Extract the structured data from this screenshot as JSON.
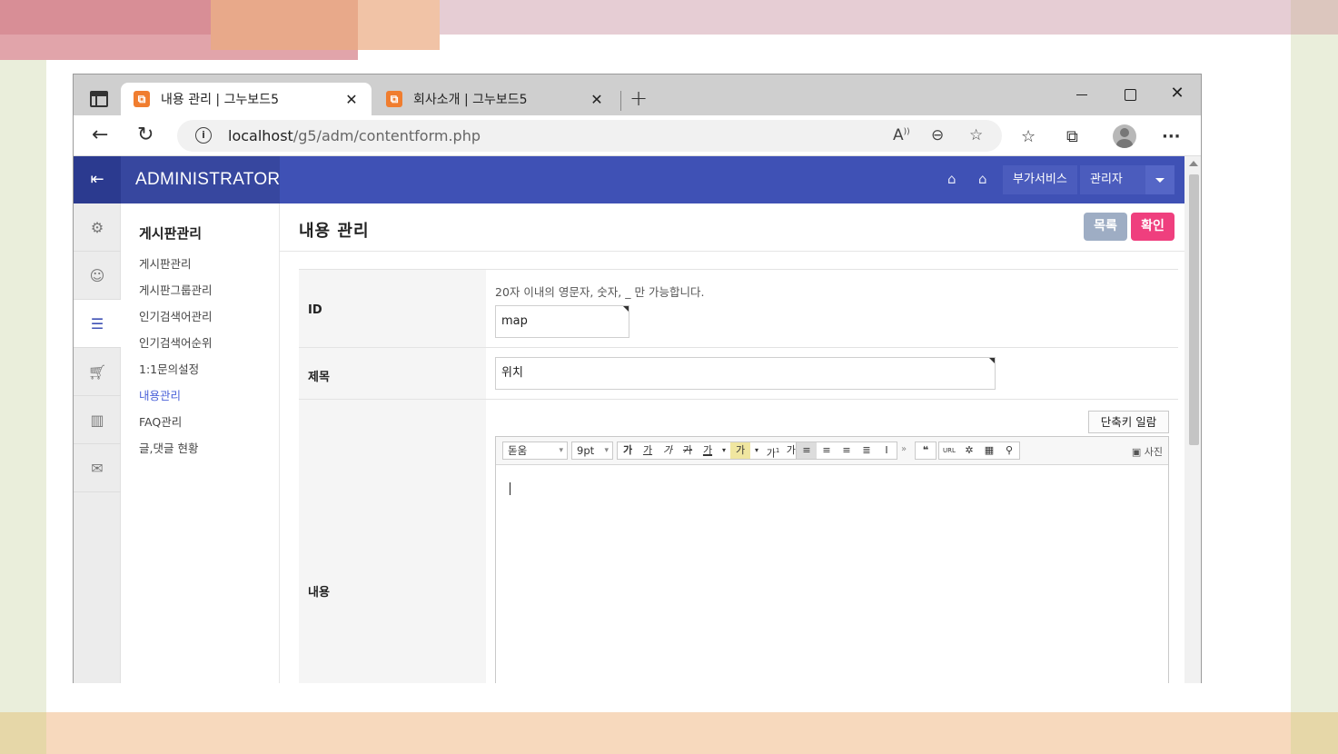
{
  "browser": {
    "tabs": [
      {
        "title": "내용 관리 | 그누보드5",
        "favicon": "gnuboard-icon",
        "active": true
      },
      {
        "title": "회사소개 | 그누보드5",
        "favicon": "gnuboard-icon",
        "active": false
      }
    ],
    "url_host": "localhost",
    "url_path": "/g5/adm/contentform.php"
  },
  "header": {
    "brand": "ADMINISTRATOR",
    "addon_label": "부가서비스",
    "admin_label": "관리자",
    "colors": {
      "primary": "#3f51b5",
      "dark": "#2b3a8f"
    }
  },
  "rail": {
    "icons": [
      "gear-icon",
      "user-icon",
      "list-icon",
      "cart-icon",
      "chart-icon",
      "mail-icon"
    ],
    "active_index": 2
  },
  "submenu": {
    "title": "게시판관리",
    "items": [
      "게시판관리",
      "게시판그룹관리",
      "인기검색어관리",
      "인기검색어순위",
      "1:1문의설정",
      "내용관리",
      "FAQ관리",
      "글,댓글 현황"
    ],
    "current_index": 5
  },
  "page": {
    "title": "내용 관리",
    "list_button": "목록",
    "confirm_button": "확인"
  },
  "form": {
    "id_label": "ID",
    "id_help": "20자 이내의 영문자, 숫자, _ 만 가능합니다.",
    "id_value": "map",
    "subject_label": "제목",
    "subject_value": "위치",
    "content_label": "내용",
    "shortcut_button": "단축키 일람",
    "editor": {
      "font": "돋움",
      "size": "9pt",
      "photo_label": "사진"
    }
  }
}
